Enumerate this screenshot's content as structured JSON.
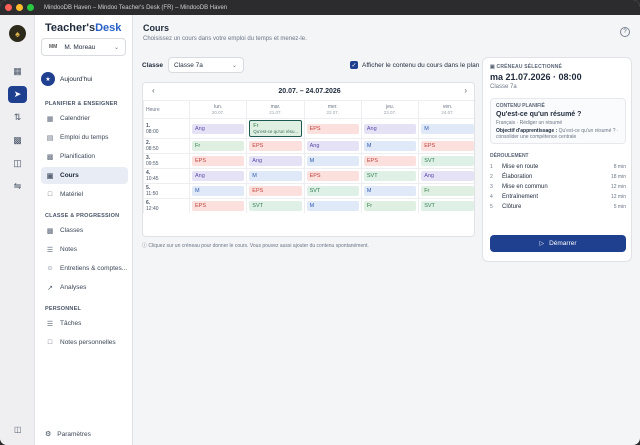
{
  "window": {
    "title": "MindooDB Haven – Mindoo Teacher's Desk (FR) – MindooDB Haven"
  },
  "app": {
    "title_part1": "Teacher's",
    "title_part2": "Desk"
  },
  "user": {
    "initials": "MM",
    "name": "M. Moreau"
  },
  "today": {
    "label": "Aujourd'hui"
  },
  "sections": {
    "plan": "PLANIFIER & ENSEIGNER",
    "class": "CLASSE & PROGRESSION",
    "personal": "PERSONNEL"
  },
  "nav": {
    "calendrier": "Calendrier",
    "emploi": "Emploi du temps",
    "planification": "Planification",
    "cours": "Cours",
    "materiel": "Matériel",
    "classes": "Classes",
    "notes": "Notes",
    "entretiens": "Entretiens & comptes...",
    "analyses": "Analyses",
    "taches": "Tâches",
    "notes_perso": "Notes personnelles",
    "parametres": "Paramètres"
  },
  "page": {
    "title": "Cours",
    "subtitle": "Choisissez un cours dans votre emploi du temps et menez-le."
  },
  "filter": {
    "class_label": "Classe",
    "class_value": "Classe 7a",
    "show_content_label": "Afficher le contenu du cours dans le plan"
  },
  "calendar": {
    "range": "20.07. – 24.07.2026",
    "hour_label": "Heure",
    "days": [
      {
        "name": "lun.",
        "date": "20.07."
      },
      {
        "name": "mar.",
        "date": "21.07."
      },
      {
        "name": "mer.",
        "date": "22.07."
      },
      {
        "name": "jeu.",
        "date": "23.07."
      },
      {
        "name": "ven.",
        "date": "24.07."
      }
    ],
    "rows": [
      {
        "num": "1.",
        "time": "08:00",
        "cells": [
          "Ang",
          "Fr",
          "EPS",
          "Ang",
          "M"
        ]
      },
      {
        "num": "2.",
        "time": "08:50",
        "cells": [
          "Fr",
          "EPS",
          "Ang",
          "M",
          "EPS"
        ]
      },
      {
        "num": "3.",
        "time": "09:55",
        "cells": [
          "EPS",
          "Ang",
          "M",
          "EPS",
          "SVT"
        ]
      },
      {
        "num": "4.",
        "time": "10:45",
        "cells": [
          "Ang",
          "M",
          "EPS",
          "SVT",
          "Ang"
        ]
      },
      {
        "num": "5.",
        "time": "11:50",
        "cells": [
          "M",
          "EPS",
          "SVT",
          "M",
          "Fr"
        ]
      },
      {
        "num": "6.",
        "time": "12:40",
        "cells": [
          "EPS",
          "SVT",
          "M",
          "Fr",
          "SVT"
        ]
      }
    ],
    "selected_subtitle": "Qu'est-ce qu'un résu...",
    "hint": "Cliquez sur un créneau pour donner le cours. Vous pouvez aussi ajouter du contenu spontanément."
  },
  "colors": {
    "accent": "#1f3f8f",
    "Ang": "#e6e2f6",
    "Fr": "#dff0e3",
    "EPS": "#fbe0de",
    "M": "#e0e9f8",
    "SVT": "#dff1e6"
  },
  "panel": {
    "label": "CRÉNEAU SÉLECTIONNÉ",
    "date": "ma 21.07.2026 · 08:00",
    "class": "Classe 7a",
    "planned_label": "CONTENU PLANIFIÉ",
    "planned_title": "Qu'est-ce qu'un résumé ?",
    "planned_subject": "Français · Rédiger un résumé",
    "objective_label": "Objectif d'apprentissage :",
    "objective_text": "Qu'est-ce qu'un résumé ? · consolider une compétence centrale",
    "flow_label": "DÉROULEMENT",
    "steps": [
      {
        "n": "1",
        "name": "Mise en route",
        "min": "8 min"
      },
      {
        "n": "2",
        "name": "Élaboration",
        "min": "18 min"
      },
      {
        "n": "3",
        "name": "Mise en commun",
        "min": "12 min"
      },
      {
        "n": "4",
        "name": "Entraînement",
        "min": "12 min"
      },
      {
        "n": "5",
        "name": "Clôture",
        "min": "5 min"
      }
    ],
    "start_label": "Démarrer"
  }
}
